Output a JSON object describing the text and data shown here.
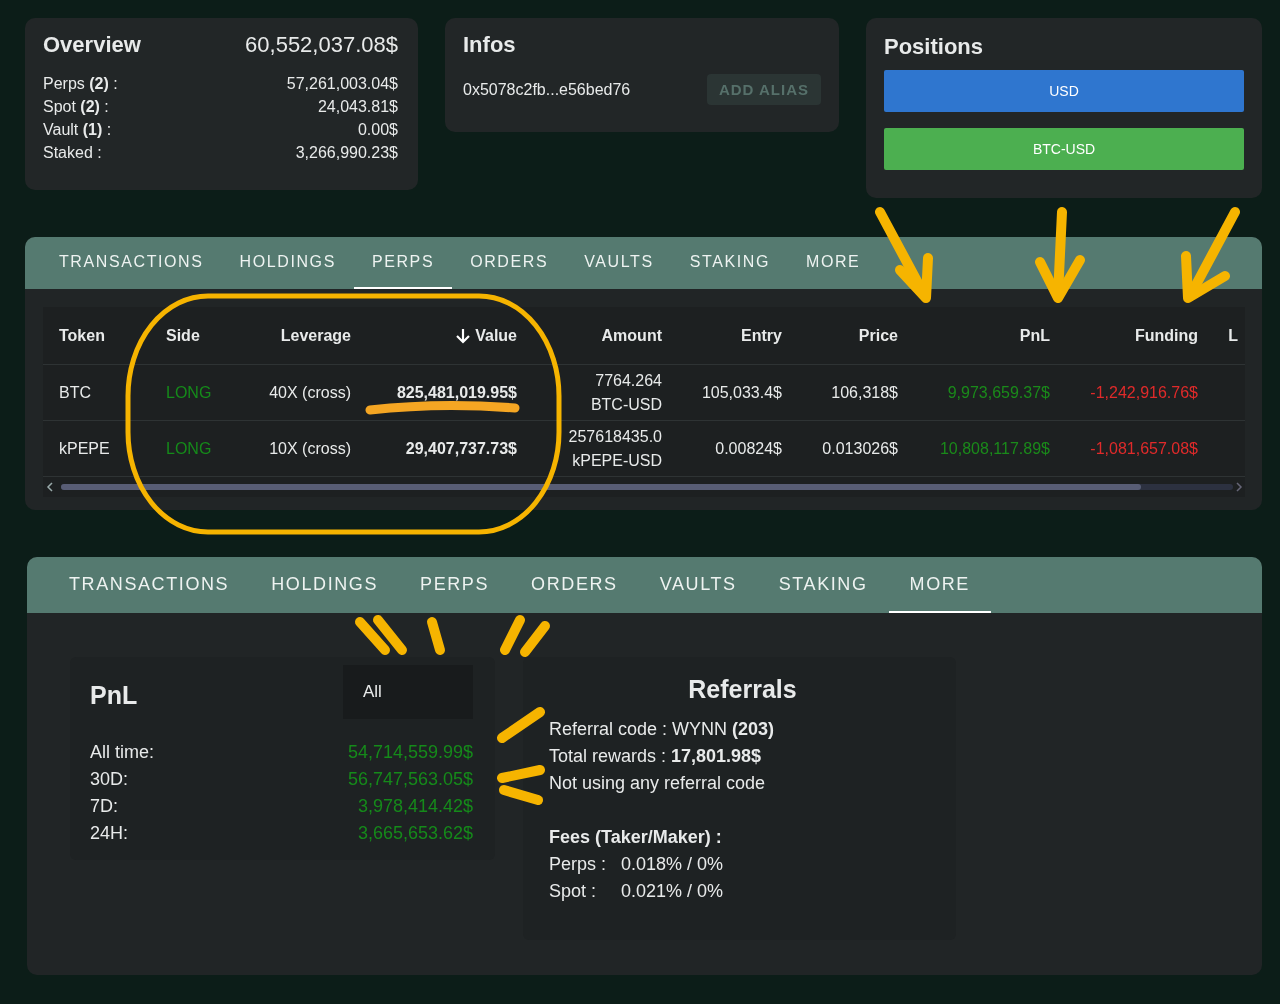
{
  "overview": {
    "title": "Overview",
    "total": "60,552,037.08$",
    "rows": [
      {
        "label": "Perps **(2)** :",
        "value": "57,261,003.04$"
      },
      {
        "label": "Spot **(2)** :",
        "value": "24,043.81$"
      },
      {
        "label": "Vault **(1)** :",
        "value": "0.00$"
      },
      {
        "label": "Staked :",
        "value": "3,266,990.23$"
      }
    ]
  },
  "infos": {
    "title": "Infos",
    "address": "0x5078c2fb...e56bed76",
    "button": "ADD ALIAS"
  },
  "positions": {
    "title": "Positions",
    "bars": [
      {
        "label": "USD",
        "color": "#2f76cf"
      },
      {
        "label": "BTC-USD",
        "color": "#4caf50"
      }
    ]
  },
  "perps_panel": {
    "tabs": [
      {
        "label": "TRANSACTIONS",
        "selected": false
      },
      {
        "label": "HOLDINGS",
        "selected": false
      },
      {
        "label": "PERPS",
        "selected": true
      },
      {
        "label": "ORDERS",
        "selected": false
      },
      {
        "label": "VAULTS",
        "selected": false
      },
      {
        "label": "STAKING",
        "selected": false
      },
      {
        "label": "MORE",
        "selected": false
      }
    ],
    "table": {
      "columns": [
        {
          "label": "Token",
          "sorted": false
        },
        {
          "label": "Side",
          "sorted": false
        },
        {
          "label": "Leverage",
          "sorted": false
        },
        {
          "label": "Value",
          "sorted": true
        },
        {
          "label": "Amount",
          "sorted": false
        },
        {
          "label": "Entry",
          "sorted": false
        },
        {
          "label": "Price",
          "sorted": false
        },
        {
          "label": "PnL",
          "sorted": false
        },
        {
          "label": "Funding",
          "sorted": false
        },
        {
          "label": "L",
          "sorted": false
        }
      ],
      "rows": [
        {
          "token": "BTC",
          "side": "LONG",
          "side_long": true,
          "leverage": "40X (cross)",
          "value": "825,481,019.95$",
          "amount": "7764.264",
          "amount_unit": "BTC-USD",
          "entry": "105,033.4$",
          "price": "106,318$",
          "pnl": "9,973,659.37$",
          "pnl_positive": true,
          "funding": "-1,242,916.76$",
          "funding_positive": false
        },
        {
          "token": "kPEPE",
          "side": "LONG",
          "side_long": true,
          "leverage": "10X (cross)",
          "value": "29,407,737.73$",
          "amount": "257618435.0",
          "amount_unit": "kPEPE-USD",
          "entry": "0.00824$",
          "price": "0.013026$",
          "pnl": "10,808,117.89$",
          "pnl_positive": true,
          "funding": "-1,081,657.08$",
          "funding_positive": false
        }
      ]
    }
  },
  "more_panel": {
    "tabs": [
      {
        "label": "TRANSACTIONS",
        "selected": false
      },
      {
        "label": "HOLDINGS",
        "selected": false
      },
      {
        "label": "PERPS",
        "selected": false
      },
      {
        "label": "ORDERS",
        "selected": false
      },
      {
        "label": "VAULTS",
        "selected": false
      },
      {
        "label": "STAKING",
        "selected": false
      },
      {
        "label": "MORE",
        "selected": true
      }
    ],
    "pnl": {
      "title": "PnL",
      "range": "All",
      "rows": [
        {
          "label": "All time:",
          "value": "54,714,559.99$"
        },
        {
          "label": "30D:",
          "value": "56,747,563.05$"
        },
        {
          "label": "7D:",
          "value": "3,978,414.42$"
        },
        {
          "label": "24H:",
          "value": "3,665,653.62$"
        }
      ]
    },
    "referrals": {
      "title": "Referrals",
      "lines": [
        "Referral code : WYNN **(203)**",
        "Total rewards : **17,801.98$**",
        "Not using any referral code"
      ],
      "fees_title": "Fees (Taker/Maker) :",
      "fees": [
        {
          "label": "Perps :",
          "value": "0.018% / 0%"
        },
        {
          "label": "Spot :",
          "value": "0.021% / 0%"
        }
      ]
    }
  }
}
